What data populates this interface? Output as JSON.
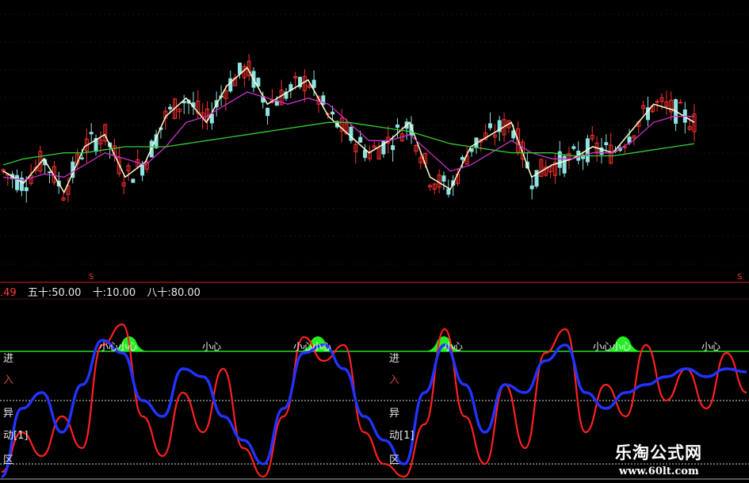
{
  "legend": {
    "first_value": ".49",
    "items": [
      {
        "label": "五十:",
        "value": "50.00"
      },
      {
        "label": "十:",
        "value": "10.00"
      },
      {
        "label": "八十:",
        "value": "80.00"
      }
    ]
  },
  "side_labels_left": [
    "进",
    "入",
    "异",
    "动[1]",
    "区"
  ],
  "side_labels_mid": [
    "进",
    "入",
    "异",
    "动[1]",
    "区"
  ],
  "warning_texts": [
    "小心小心",
    "小心",
    "小心小心",
    "小心",
    "小心小心",
    "小心"
  ],
  "s_marker": "S",
  "watermark": {
    "name": "乐淘公式网",
    "url": "www.60lt.com"
  },
  "colors": {
    "background": "#000000",
    "up_candle": "#ff3030",
    "down_candle": "#8fe3e3",
    "ma_short": "#ffffcc",
    "ma_mid": "#cc33cc",
    "ma_long": "#33cc33",
    "osc_red": "#ff2020",
    "osc_blue": "#2233ff",
    "peak_green": "#22ee22",
    "level_line": "#22dd22",
    "divider": "#cc2222"
  },
  "chart_data": [
    {
      "type": "line",
      "panel": "price",
      "series": [
        {
          "values": [
            62,
            58,
            66,
            55,
            70,
            74,
            60,
            65,
            80,
            86,
            78,
            90,
            96,
            84,
            88,
            92,
            80,
            74,
            68,
            72,
            78,
            60,
            56,
            70,
            74,
            78,
            60,
            64,
            66,
            70,
            68,
            76,
            84,
            82,
            78
          ]
        },
        {
          "values": [
            60,
            59,
            61,
            60,
            64,
            68,
            66,
            64,
            70,
            78,
            80,
            84,
            88,
            86,
            84,
            86,
            84,
            78,
            72,
            72,
            74,
            68,
            62,
            64,
            68,
            72,
            68,
            66,
            66,
            68,
            68,
            72,
            78,
            80,
            80
          ]
        },
        {
          "values": [
            64,
            66,
            67,
            68,
            68,
            69,
            70,
            70,
            70,
            71,
            72,
            73,
            74,
            75,
            76,
            77,
            78,
            78,
            77,
            76,
            75,
            73,
            71,
            70,
            69,
            68,
            68,
            68,
            67,
            67,
            67,
            68,
            69,
            70,
            71
          ]
        }
      ]
    },
    {
      "type": "line",
      "panel": "oscillator",
      "ylim": [
        0,
        100
      ],
      "levels": [
        10,
        50,
        80
      ],
      "series": [
        {
          "values": [
            5,
            30,
            15,
            40,
            20,
            85,
            98,
            40,
            15,
            55,
            30,
            70,
            20,
            2,
            40,
            90,
            75,
            85,
            30,
            10,
            2,
            35,
            95,
            40,
            10,
            60,
            20,
            80,
            95,
            30,
            60,
            40,
            85,
            50,
            70,
            45,
            80,
            55
          ]
        },
        {
          "values": [
            2,
            45,
            55,
            30,
            60,
            88,
            80,
            50,
            40,
            70,
            65,
            40,
            25,
            10,
            45,
            80,
            85,
            70,
            40,
            25,
            10,
            55,
            85,
            60,
            30,
            60,
            55,
            75,
            85,
            55,
            45,
            55,
            60,
            65,
            70,
            65,
            70,
            68
          ]
        }
      ]
    }
  ]
}
